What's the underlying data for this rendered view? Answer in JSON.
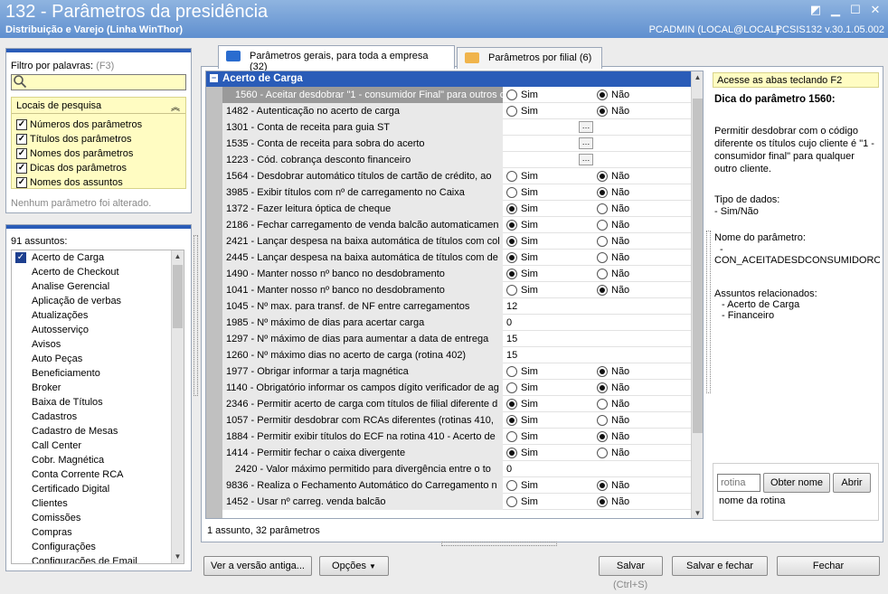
{
  "window": {
    "title": "132 - Parâmetros da presidência",
    "subtitle": "Distribuição e Varejo (Linha WinThor)",
    "user": "PCADMIN (LOCAL@LOCAL)",
    "version": "PCSIS132  v.30.1.05.002"
  },
  "filter": {
    "label": "Filtro por palavras:",
    "shortcut": "(F3)",
    "value": "",
    "locais_title": "Locais de pesquisa",
    "options": [
      {
        "label": "Números dos parâmetros",
        "checked": true
      },
      {
        "label": "Títulos dos parâmetros",
        "checked": true
      },
      {
        "label": "Nomes dos parâmetros",
        "checked": true
      },
      {
        "label": "Dicas dos parâmetros",
        "checked": true
      },
      {
        "label": "Nomes dos assuntos",
        "checked": true
      }
    ],
    "status": "Nenhum parâmetro foi alterado."
  },
  "assuntos": {
    "title": "91 assuntos:",
    "items": [
      "Acerto de Carga",
      "Acerto de Checkout",
      "Analise Gerencial",
      "Aplicação de verbas",
      "Atualizações",
      "Autosserviço",
      "Avisos",
      "Auto Peças",
      "Beneficiamento",
      "Broker",
      "Baixa de Títulos",
      "Cadastros",
      "Cadastro de Mesas",
      "Call Center",
      "Cobr. Magnética",
      "Conta Corrente RCA",
      "Certificado Digital",
      "Clientes",
      "Comissões",
      "Compras",
      "Configurações",
      "Configurações de Email"
    ]
  },
  "tabs": [
    {
      "label": "Parâmetros gerais, para toda a empresa (32)",
      "active": true
    },
    {
      "label": "Parâmetros por filial  (6)",
      "active": false
    }
  ],
  "grid": {
    "group": "Acerto de Carga",
    "sim": "Sim",
    "nao": "Não",
    "rows": [
      {
        "name": "1560 - Aceitar desdobrar \"1 - consumidor Final\" para outros c",
        "type": "radio",
        "value": "nao",
        "indent": true,
        "selected": true
      },
      {
        "name": "1482 - Autenticação no acerto de carga",
        "type": "radio",
        "value": "nao"
      },
      {
        "name": "1301 - Conta de receita para guia ST",
        "type": "lookup"
      },
      {
        "name": "1535 - Conta de receita para sobra do acerto",
        "type": "lookup"
      },
      {
        "name": "1223 - Cód. cobrança desconto financeiro",
        "type": "lookup"
      },
      {
        "name": "1564 - Desdobrar automático títulos de cartão de crédito, ao",
        "type": "radio",
        "value": "nao"
      },
      {
        "name": "3985 - Exibir títulos com nº de carregamento no Caixa",
        "type": "radio",
        "value": "nao"
      },
      {
        "name": "1372 - Fazer leitura óptica de cheque",
        "type": "radio",
        "value": "sim"
      },
      {
        "name": "2186 - Fechar carregamento de venda balcão automaticamen",
        "type": "radio",
        "value": "sim"
      },
      {
        "name": "2421 - Lançar despesa na baixa automática de títulos com col",
        "type": "radio",
        "value": "sim"
      },
      {
        "name": "2445 - Lançar despesa na baixa automática de títulos com de",
        "type": "radio",
        "value": "sim"
      },
      {
        "name": "1490 - Manter nosso nº banco no desdobramento",
        "type": "radio",
        "value": "sim"
      },
      {
        "name": "1041 - Manter nosso nº banco no desdobramento",
        "type": "radio",
        "value": "nao"
      },
      {
        "name": "1045 - Nº max. para transf. de NF entre carregamentos",
        "type": "text",
        "value": "12"
      },
      {
        "name": "1985 - Nº máximo de dias para acertar carga",
        "type": "text",
        "value": "0"
      },
      {
        "name": "1297 - Nº máximo de dias para aumentar a data de entrega",
        "type": "text",
        "value": "15"
      },
      {
        "name": "1260 - Nº máximo dias no acerto de carga (rotina 402)",
        "type": "text",
        "value": "15"
      },
      {
        "name": "1977 - Obrigar informar a tarja magnética",
        "type": "radio",
        "value": "nao"
      },
      {
        "name": "1140 - Obrigatório informar os campos dígito verificador de ag",
        "type": "radio",
        "value": "nao"
      },
      {
        "name": "2346 - Permitir acerto de carga com títulos de filial diferente d",
        "type": "radio",
        "value": "sim"
      },
      {
        "name": "1057 - Permitir desdobrar com RCAs diferentes (rotinas 410,",
        "type": "radio",
        "value": "sim"
      },
      {
        "name": "1884 - Permitir exibir títulos do ECF na rotina 410 - Acerto de",
        "type": "radio",
        "value": "nao"
      },
      {
        "name": "1414 - Permitir fechar o caixa divergente",
        "type": "radio",
        "value": "sim"
      },
      {
        "name": "2420 - Valor máximo permitido para divergência entre o to",
        "type": "text",
        "value": "0",
        "indent": true
      },
      {
        "name": "9836 - Realiza o Fechamento Automático do Carregamento n",
        "type": "radio",
        "value": "nao"
      },
      {
        "name": "1452 - Usar nº carreg. venda balcão",
        "type": "radio",
        "value": "nao"
      }
    ],
    "footer": "1 assunto, 32 parâmetros"
  },
  "tip": {
    "hint": "Acesse as abas teclando F2",
    "title": "Dica do parâmetro 1560:",
    "desc": "Permitir desdobrar com o código diferente os títulos cujo cliente é \"1 - consumidor final\" para qualquer outro cliente.",
    "tipo_label": "Tipo de dados:",
    "tipo_value": "- Sim/Não",
    "nome_label": "Nome do parâmetro:",
    "nome_dash": "-",
    "nome_value": "CON_ACEITADESDCONSUMIDOROUT",
    "rel_label": "Assuntos relacionados:",
    "rel_items": [
      "- Acerto de Carga",
      "- Financeiro"
    ]
  },
  "rotina": {
    "placeholder": "rotina",
    "obter": "Obter nome",
    "abrir": "Abrir",
    "caption": "nome da rotina"
  },
  "buttons": {
    "versao": "Ver a versão antiga...",
    "opcoes": "Opções",
    "salvar": "Salvar",
    "salvar_hint": "(Ctrl+S)",
    "salvar_fechar": "Salvar e fechar",
    "fechar": "Fechar"
  }
}
